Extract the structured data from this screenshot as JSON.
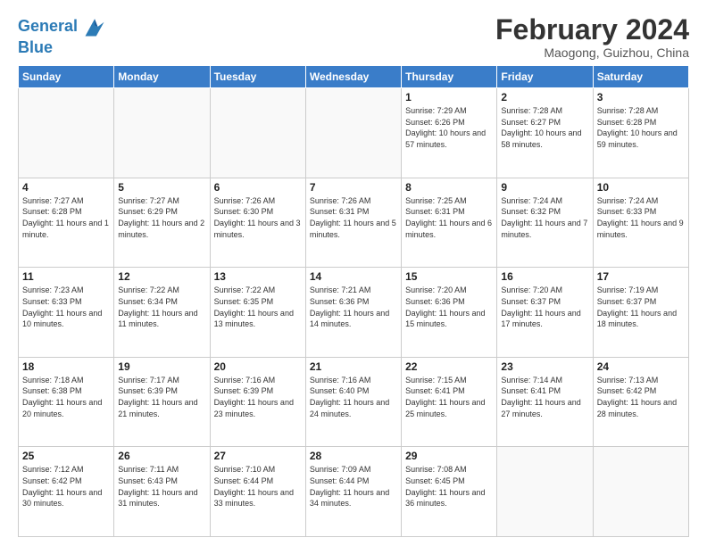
{
  "logo": {
    "line1": "General",
    "line2": "Blue"
  },
  "title": "February 2024",
  "location": "Maogong, Guizhou, China",
  "days_of_week": [
    "Sunday",
    "Monday",
    "Tuesday",
    "Wednesday",
    "Thursday",
    "Friday",
    "Saturday"
  ],
  "weeks": [
    [
      {
        "day": "",
        "info": ""
      },
      {
        "day": "",
        "info": ""
      },
      {
        "day": "",
        "info": ""
      },
      {
        "day": "",
        "info": ""
      },
      {
        "day": "1",
        "info": "Sunrise: 7:29 AM\nSunset: 6:26 PM\nDaylight: 10 hours\nand 57 minutes."
      },
      {
        "day": "2",
        "info": "Sunrise: 7:28 AM\nSunset: 6:27 PM\nDaylight: 10 hours\nand 58 minutes."
      },
      {
        "day": "3",
        "info": "Sunrise: 7:28 AM\nSunset: 6:28 PM\nDaylight: 10 hours\nand 59 minutes."
      }
    ],
    [
      {
        "day": "4",
        "info": "Sunrise: 7:27 AM\nSunset: 6:28 PM\nDaylight: 11 hours\nand 1 minute."
      },
      {
        "day": "5",
        "info": "Sunrise: 7:27 AM\nSunset: 6:29 PM\nDaylight: 11 hours\nand 2 minutes."
      },
      {
        "day": "6",
        "info": "Sunrise: 7:26 AM\nSunset: 6:30 PM\nDaylight: 11 hours\nand 3 minutes."
      },
      {
        "day": "7",
        "info": "Sunrise: 7:26 AM\nSunset: 6:31 PM\nDaylight: 11 hours\nand 5 minutes."
      },
      {
        "day": "8",
        "info": "Sunrise: 7:25 AM\nSunset: 6:31 PM\nDaylight: 11 hours\nand 6 minutes."
      },
      {
        "day": "9",
        "info": "Sunrise: 7:24 AM\nSunset: 6:32 PM\nDaylight: 11 hours\nand 7 minutes."
      },
      {
        "day": "10",
        "info": "Sunrise: 7:24 AM\nSunset: 6:33 PM\nDaylight: 11 hours\nand 9 minutes."
      }
    ],
    [
      {
        "day": "11",
        "info": "Sunrise: 7:23 AM\nSunset: 6:33 PM\nDaylight: 11 hours\nand 10 minutes."
      },
      {
        "day": "12",
        "info": "Sunrise: 7:22 AM\nSunset: 6:34 PM\nDaylight: 11 hours\nand 11 minutes."
      },
      {
        "day": "13",
        "info": "Sunrise: 7:22 AM\nSunset: 6:35 PM\nDaylight: 11 hours\nand 13 minutes."
      },
      {
        "day": "14",
        "info": "Sunrise: 7:21 AM\nSunset: 6:36 PM\nDaylight: 11 hours\nand 14 minutes."
      },
      {
        "day": "15",
        "info": "Sunrise: 7:20 AM\nSunset: 6:36 PM\nDaylight: 11 hours\nand 15 minutes."
      },
      {
        "day": "16",
        "info": "Sunrise: 7:20 AM\nSunset: 6:37 PM\nDaylight: 11 hours\nand 17 minutes."
      },
      {
        "day": "17",
        "info": "Sunrise: 7:19 AM\nSunset: 6:37 PM\nDaylight: 11 hours\nand 18 minutes."
      }
    ],
    [
      {
        "day": "18",
        "info": "Sunrise: 7:18 AM\nSunset: 6:38 PM\nDaylight: 11 hours\nand 20 minutes."
      },
      {
        "day": "19",
        "info": "Sunrise: 7:17 AM\nSunset: 6:39 PM\nDaylight: 11 hours\nand 21 minutes."
      },
      {
        "day": "20",
        "info": "Sunrise: 7:16 AM\nSunset: 6:39 PM\nDaylight: 11 hours\nand 23 minutes."
      },
      {
        "day": "21",
        "info": "Sunrise: 7:16 AM\nSunset: 6:40 PM\nDaylight: 11 hours\nand 24 minutes."
      },
      {
        "day": "22",
        "info": "Sunrise: 7:15 AM\nSunset: 6:41 PM\nDaylight: 11 hours\nand 25 minutes."
      },
      {
        "day": "23",
        "info": "Sunrise: 7:14 AM\nSunset: 6:41 PM\nDaylight: 11 hours\nand 27 minutes."
      },
      {
        "day": "24",
        "info": "Sunrise: 7:13 AM\nSunset: 6:42 PM\nDaylight: 11 hours\nand 28 minutes."
      }
    ],
    [
      {
        "day": "25",
        "info": "Sunrise: 7:12 AM\nSunset: 6:42 PM\nDaylight: 11 hours\nand 30 minutes."
      },
      {
        "day": "26",
        "info": "Sunrise: 7:11 AM\nSunset: 6:43 PM\nDaylight: 11 hours\nand 31 minutes."
      },
      {
        "day": "27",
        "info": "Sunrise: 7:10 AM\nSunset: 6:44 PM\nDaylight: 11 hours\nand 33 minutes."
      },
      {
        "day": "28",
        "info": "Sunrise: 7:09 AM\nSunset: 6:44 PM\nDaylight: 11 hours\nand 34 minutes."
      },
      {
        "day": "29",
        "info": "Sunrise: 7:08 AM\nSunset: 6:45 PM\nDaylight: 11 hours\nand 36 minutes."
      },
      {
        "day": "",
        "info": ""
      },
      {
        "day": "",
        "info": ""
      }
    ]
  ]
}
